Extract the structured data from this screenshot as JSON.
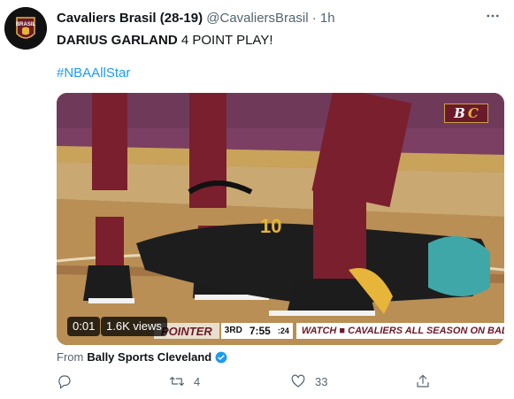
{
  "tweet": {
    "author_name": "Cavaliers Brasil (28-19)",
    "handle": "@CavaliersBrasil",
    "separator": "·",
    "time": "1h",
    "avatar_text": "BRASIL",
    "text_bold": "DARIUS GARLAND",
    "text_rest": " 4 POINT PLAY!",
    "hashtag": "#NBAAllStar"
  },
  "media": {
    "logo_text_b": "B",
    "logo_text_c": "C",
    "time_chip": "0:01",
    "views_chip": "1.6K views",
    "scorebar": {
      "pointer": "POINTER",
      "quarter": "3RD",
      "clock": "7:55",
      "shot_clock": ":24",
      "promo": "WATCH ■ CAVALIERS ALL SEASON ON BALLY SPORTS APP"
    }
  },
  "source": {
    "prefix": "From",
    "name": "Bally Sports Cleveland"
  },
  "actions": {
    "reply_count": "",
    "retweet_count": "4",
    "like_count": "33"
  },
  "colors": {
    "accent": "#1d9bf0",
    "text": "#0f1419",
    "muted": "#536471",
    "wine": "#6b1a2a",
    "gold": "#e7b53a"
  },
  "icons": [
    "more-icon",
    "reply-icon",
    "retweet-icon",
    "like-icon",
    "share-icon",
    "verified-icon"
  ]
}
